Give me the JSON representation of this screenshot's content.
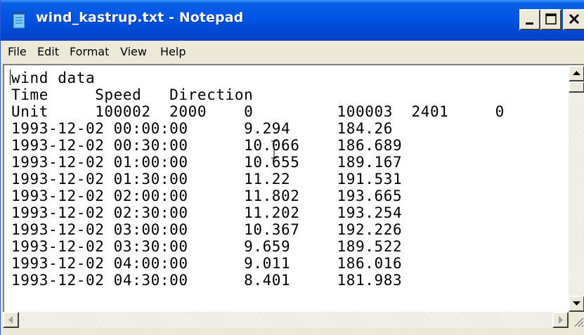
{
  "window": {
    "title": "wind_kastrup.txt - Notepad",
    "icon": "notepad-icon",
    "caption_buttons": [
      "minimize-icon",
      "maximize-icon",
      "close-icon"
    ]
  },
  "menu": {
    "items": [
      "File",
      "Edit",
      "Format",
      "View",
      "Help"
    ]
  },
  "document": {
    "lines": [
      "wind data",
      "Time     Speed   Direction",
      "Unit     100002  2000    0         100003  2401     0",
      "1993-12-02 00:00:00      9.294     184.26",
      "1993-12-02 00:30:00      10.066    186.689",
      "1993-12-02 01:00:00      10.655    189.167",
      "1993-12-02 01:30:00      11.22     191.531",
      "1993-12-02 02:00:00      11.802    193.665",
      "1993-12-02 02:30:00      11.202    193.254",
      "1993-12-02 03:00:00      10.367    192.226",
      "1993-12-02 03:30:00      9.659     189.522",
      "1993-12-02 04:00:00      9.011     186.016",
      "1993-12-02 04:30:00      8.401     181.983"
    ]
  },
  "scrollbars": {
    "icons": [
      "scroll-up-arrow-icon",
      "scroll-down-arrow-icon",
      "scroll-left-arrow-icon",
      "scroll-right-arrow-icon",
      "size-grip-icon"
    ]
  }
}
